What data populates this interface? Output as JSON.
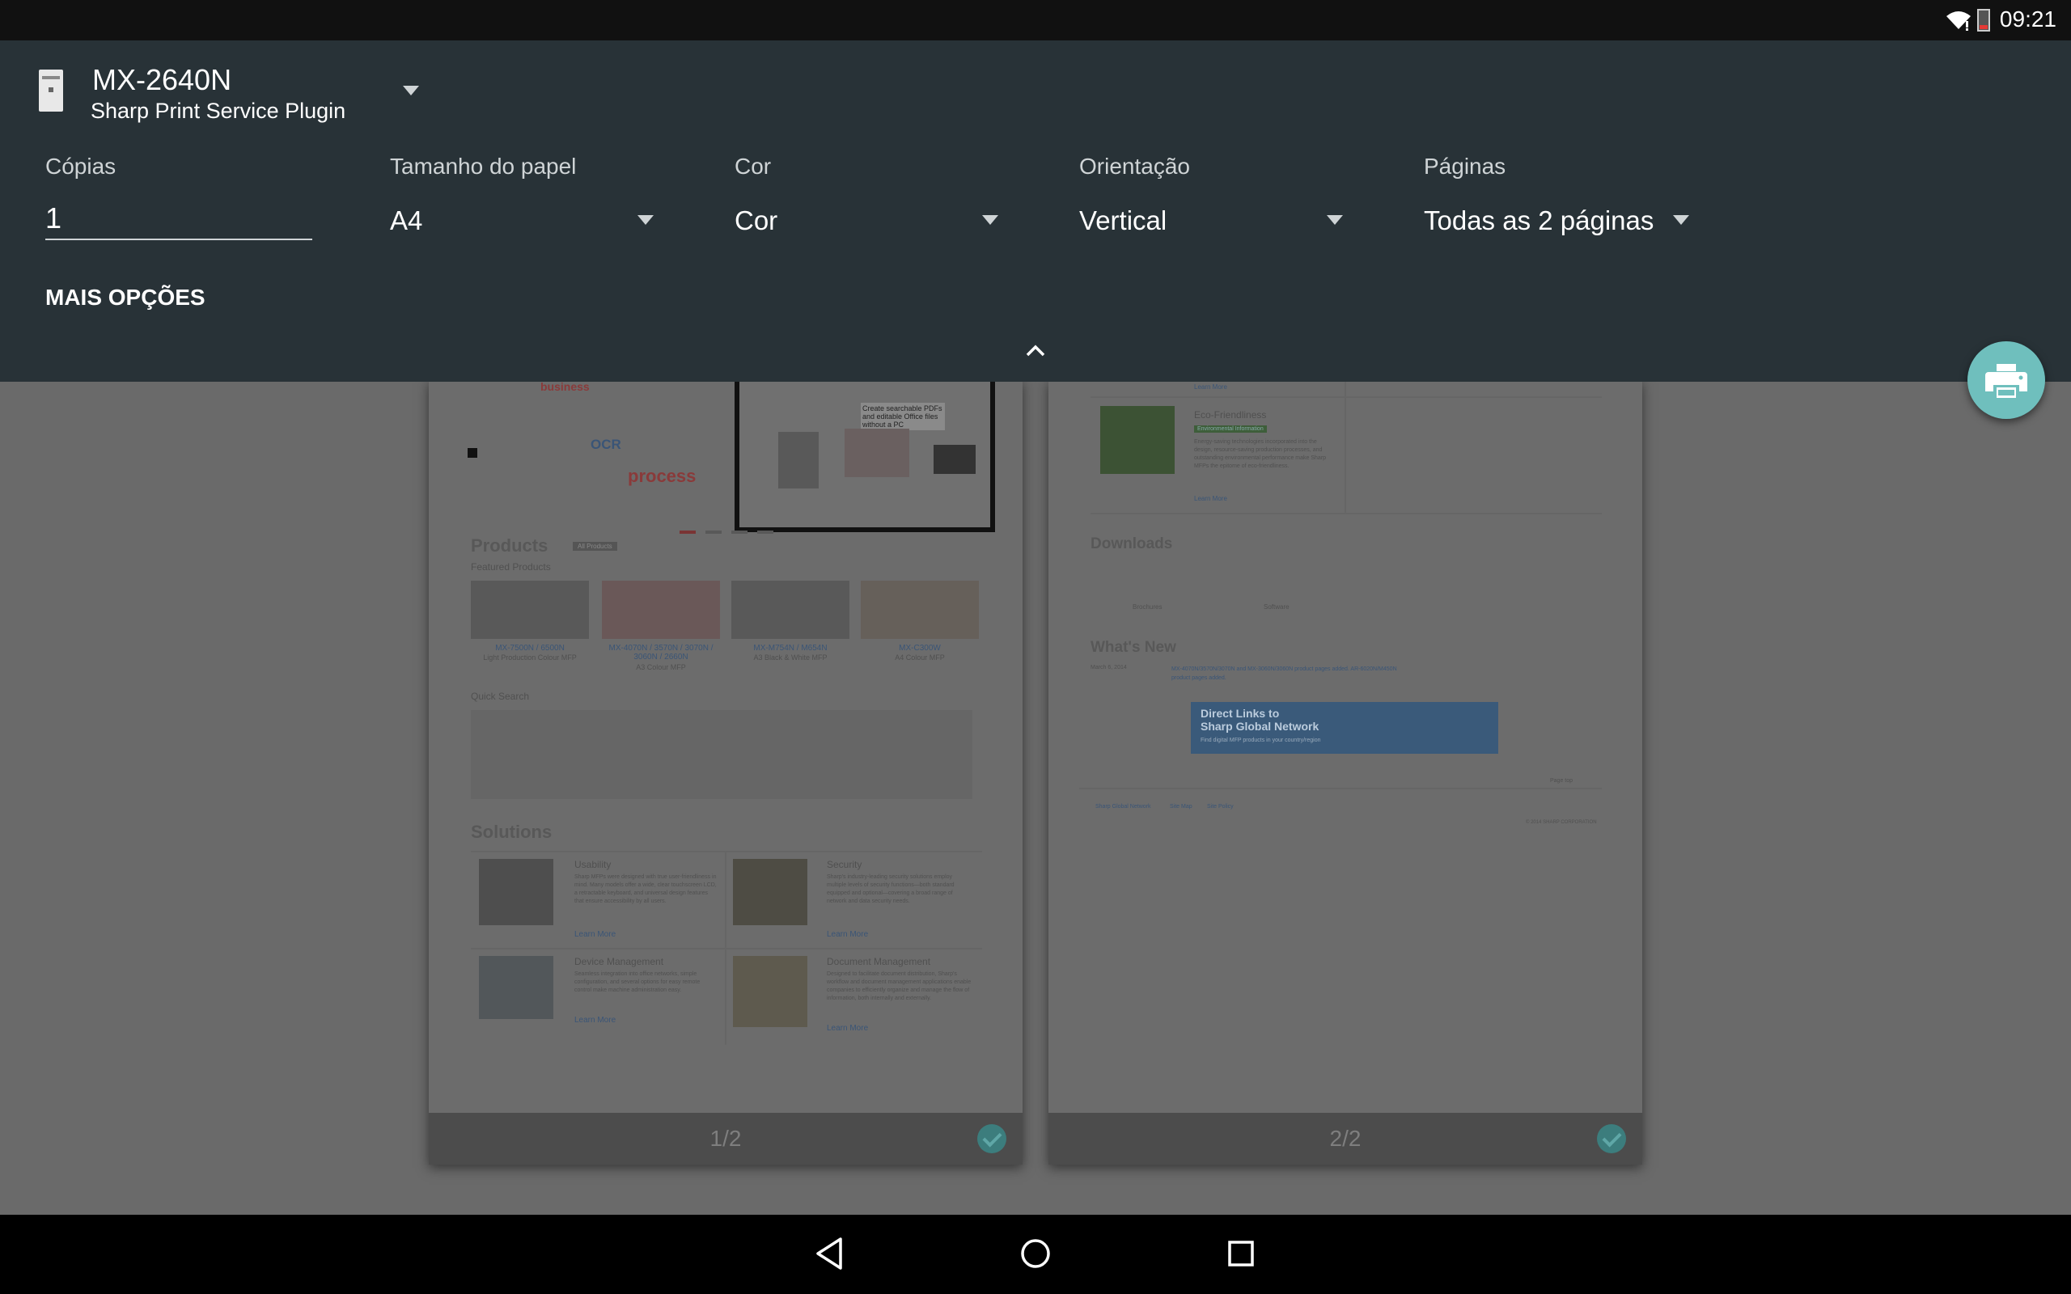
{
  "status_bar": {
    "time": "09:21",
    "icons": [
      "wifi-icon",
      "battery-icon"
    ]
  },
  "printer": {
    "name": "MX-2640N",
    "service": "Sharp Print Service Plugin",
    "icon": "printer-icon"
  },
  "options": {
    "copies": {
      "label": "Cópias",
      "value": "1"
    },
    "paper_size": {
      "label": "Tamanho do papel",
      "value": "A4"
    },
    "color": {
      "label": "Cor",
      "value": "Cor"
    },
    "orientation": {
      "label": "Orientação",
      "value": "Vertical"
    },
    "pages": {
      "label": "Páginas",
      "value": "Todas as 2 páginas"
    },
    "more_label": "MAIS OPÇÕES"
  },
  "preview": {
    "pages": [
      {
        "number": "1/2",
        "selected": true
      },
      {
        "number": "2/2",
        "selected": true
      }
    ],
    "page1": {
      "hero_words": [
        "business",
        "OCR",
        "process"
      ],
      "banner_text": "Create searchable PDFs and editable Office files without a PC",
      "products_title": "Products",
      "all_products": "All Products",
      "featured": "Featured Products",
      "products": [
        {
          "model": "MX-7500N / 6500N",
          "desc": "Light Production Colour MFP"
        },
        {
          "model": "MX-4070N / 3570N / 3070N / 3060N / 2660N",
          "desc": "A3 Colour MFP"
        },
        {
          "model": "MX-M754N / M654N",
          "desc": "A3 Black & White MFP"
        },
        {
          "model": "MX-C300W",
          "desc": "A4 Colour MFP"
        }
      ],
      "quick_search": "Quick Search",
      "solutions_title": "Solutions",
      "solutions": [
        {
          "title": "Usability",
          "text": "Sharp MFPs were designed with true user-friendliness in mind. Many models offer a wide, clear touchscreen LCD, a retractable keyboard, and universal design features that ensure accessibility by all users.",
          "more": "Learn More"
        },
        {
          "title": "Security",
          "text": "Sharp's industry-leading security solutions employ multiple levels of security functions—both standard equipped and optional—covering a broad range of network and data security needs.",
          "more": "Learn More"
        },
        {
          "title": "Device Management",
          "text": "Seamless integration into office networks, simple configuration, and several options for easy remote control make machine administration easy.",
          "more": "Learn More"
        },
        {
          "title": "Document Management",
          "text": "Designed to facilitate document distribution, Sharp's workflow and document management applications enable companies to efficiently organize and manage the flow of information, both internally and externally.",
          "more": "Learn More"
        }
      ]
    },
    "page2": {
      "learn_more": "Learn More",
      "eco_title": "Eco-Friendliness",
      "eco_badge": "Environmental Information",
      "eco_text": "Energy-saving technologies incorporated into the design, resource-saving production processes, and outstanding environmental performance make Sharp MFPs the epitome of eco-friendliness.",
      "downloads_title": "Downloads",
      "downloads": [
        "Brochures",
        "Software"
      ],
      "whats_new_title": "What's New",
      "news_date": "March 6, 2014",
      "news_text": "MX-4070N/3570N/3070N and MX-3060N/3060N product pages added. AR-6020N/M450N product pages added.",
      "direct_links_title": "Direct Links to",
      "direct_links_sub": "Sharp Global Network",
      "direct_links_caption": "Find digital MFP products in your country/region",
      "page_top": "Page top",
      "footer_links": [
        "Sharp Global Network",
        "Site Map",
        "Site Policy"
      ],
      "copyright": "© 2014 SHARP CORPORATION"
    }
  },
  "colors": {
    "header_bg": "#283237",
    "fab": "#6fbfbd",
    "scrim": "#6a6a6a"
  }
}
